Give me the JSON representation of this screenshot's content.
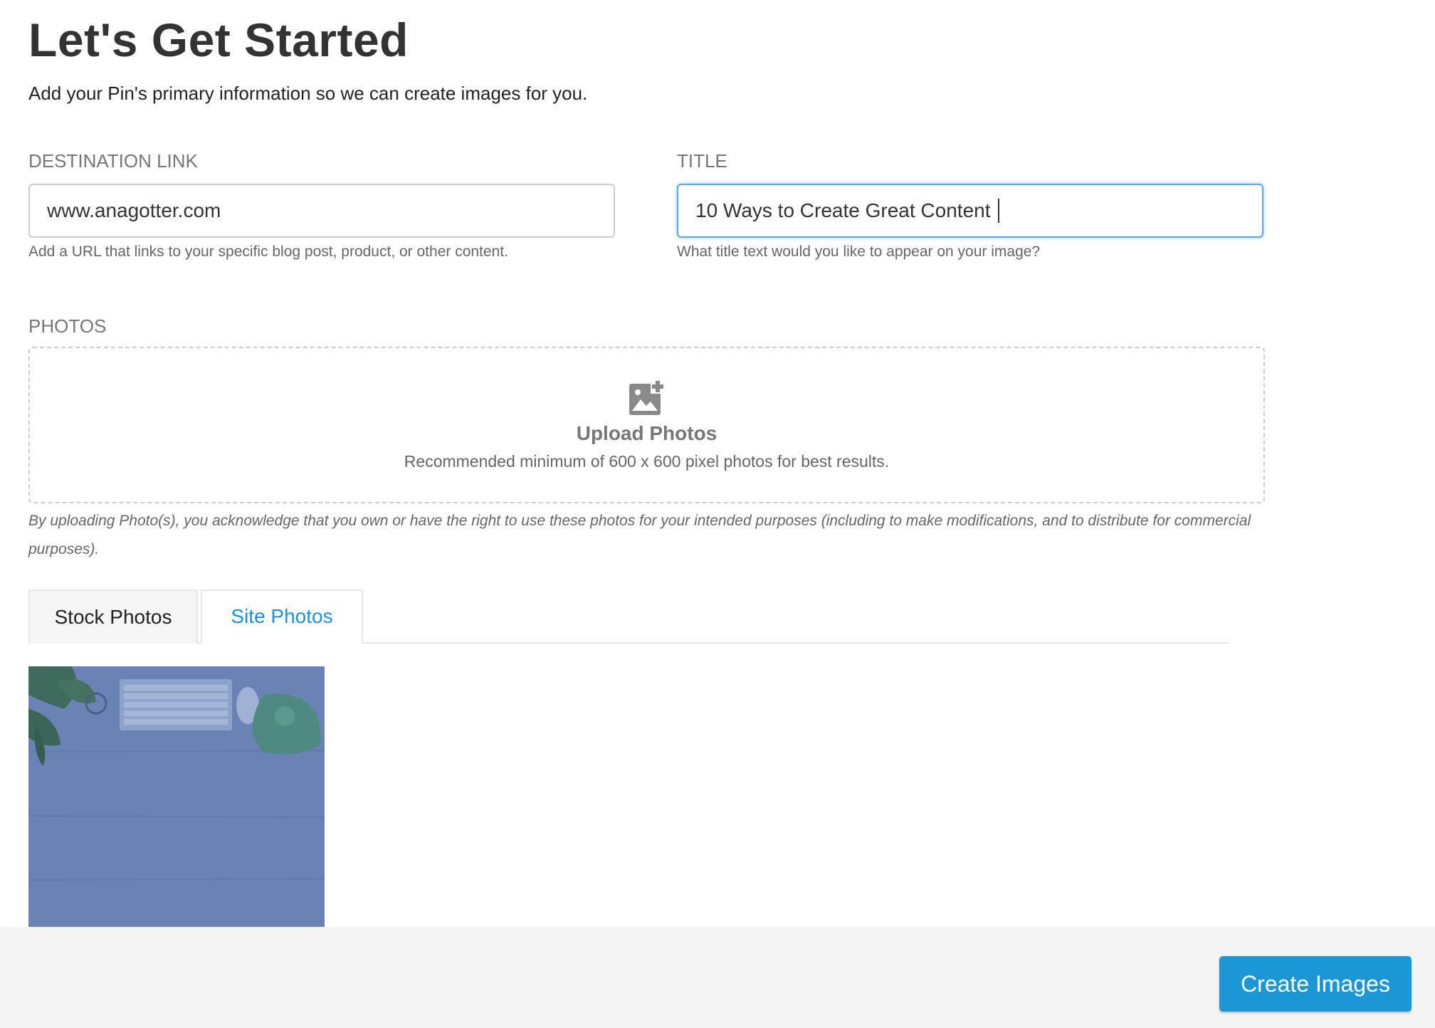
{
  "header": {
    "title": "Let's Get Started",
    "subtitle": "Add your Pin's primary information so we can create images for you."
  },
  "destination": {
    "label": "DESTINATION LINK",
    "value": "www.anagotter.com",
    "help": "Add a URL that links to your specific blog post, product, or other content."
  },
  "title_field": {
    "label": "TITLE",
    "value": "10 Ways to Create Great Content",
    "help": "What title text would you like to appear on your image?"
  },
  "photos": {
    "label": "PHOTOS",
    "upload_title": "Upload Photos",
    "upload_note": "Recommended minimum of 600 x 600 pixel photos for best results.",
    "disclaimer": "By uploading Photo(s), you acknowledge that you own or have the right to use these photos for your intended purposes (including to make modifications, and to distribute for commercial purposes)."
  },
  "tabs": [
    {
      "label": "Stock Photos",
      "active": false
    },
    {
      "label": "Site Photos",
      "active": true
    }
  ],
  "icons": {
    "upload": "add-photo-icon"
  },
  "colors": {
    "accent": "#1a8fe3",
    "button": "#1b97d6",
    "thumb_overlay": "#6b82b5"
  },
  "footer": {
    "create_label": "Create Images"
  }
}
